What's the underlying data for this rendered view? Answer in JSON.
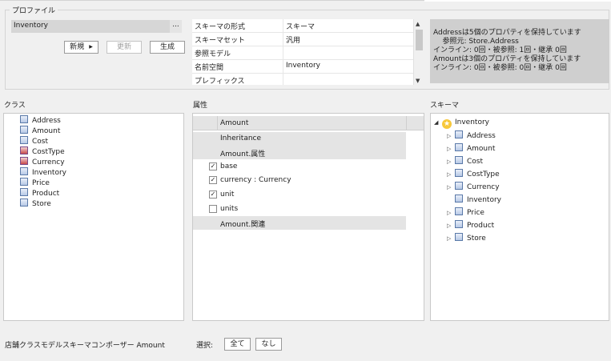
{
  "profile": {
    "group_label": "プロファイル",
    "name_value": "Inventory",
    "browse_label": "...",
    "new_label": "新規",
    "update_label": "更新",
    "generate_label": "生成"
  },
  "properties": {
    "rows": [
      {
        "key": "スキーマの形式",
        "value": "スキーマ"
      },
      {
        "key": "スキーマセット",
        "value": "汎用"
      },
      {
        "key": "参照モデル",
        "value": ""
      },
      {
        "key": "名前空間",
        "value": "Inventory"
      },
      {
        "key": "プレフィックス",
        "value": ""
      }
    ]
  },
  "info": {
    "lines": [
      "Addressは5個のプロパティを保持しています",
      "    参照元: Store.Address",
      "インライン: 0回・被参照: 1回・継承 0回",
      "Amountは3個のプロパティを保持しています",
      "インライン: 0回・被参照: 0回・継承 0回"
    ]
  },
  "classes": {
    "label": "クラス",
    "items": [
      "Address",
      "Amount",
      "Cost",
      "CostType",
      "Currency",
      "Inventory",
      "Price",
      "Product",
      "Store"
    ]
  },
  "attributes": {
    "label": "属性",
    "header": "Amount",
    "inheritance_label": "Inheritance",
    "attr_group_label": "Amount.属性",
    "items": [
      {
        "name": "base",
        "checked": true
      },
      {
        "name": "currency : Currency",
        "checked": true
      },
      {
        "name": "unit",
        "checked": true
      },
      {
        "name": "units",
        "checked": false
      }
    ],
    "relations_label": "Amount.関連"
  },
  "schema": {
    "label": "スキーマ",
    "root": "Inventory",
    "items": [
      "Address",
      "Amount",
      "Cost",
      "CostType",
      "Currency",
      "Inventory",
      "Price",
      "Product",
      "Store"
    ]
  },
  "footer": {
    "status": "店舗クラスモデルスキーマコンポーザー Amount",
    "select_label": "選択:",
    "all_label": "全て",
    "none_label": "なし"
  },
  "icons": {
    "new_menu": "chevron-right-icon",
    "scroll_up": "scroll-up-icon",
    "scroll_down": "scroll-down-icon",
    "check": "check-icon",
    "class": "class-icon",
    "enum": "enumeration-icon",
    "schema_root": "star-icon",
    "expand": "expand-arrow-icon",
    "collapse": "collapse-arrow-icon"
  }
}
